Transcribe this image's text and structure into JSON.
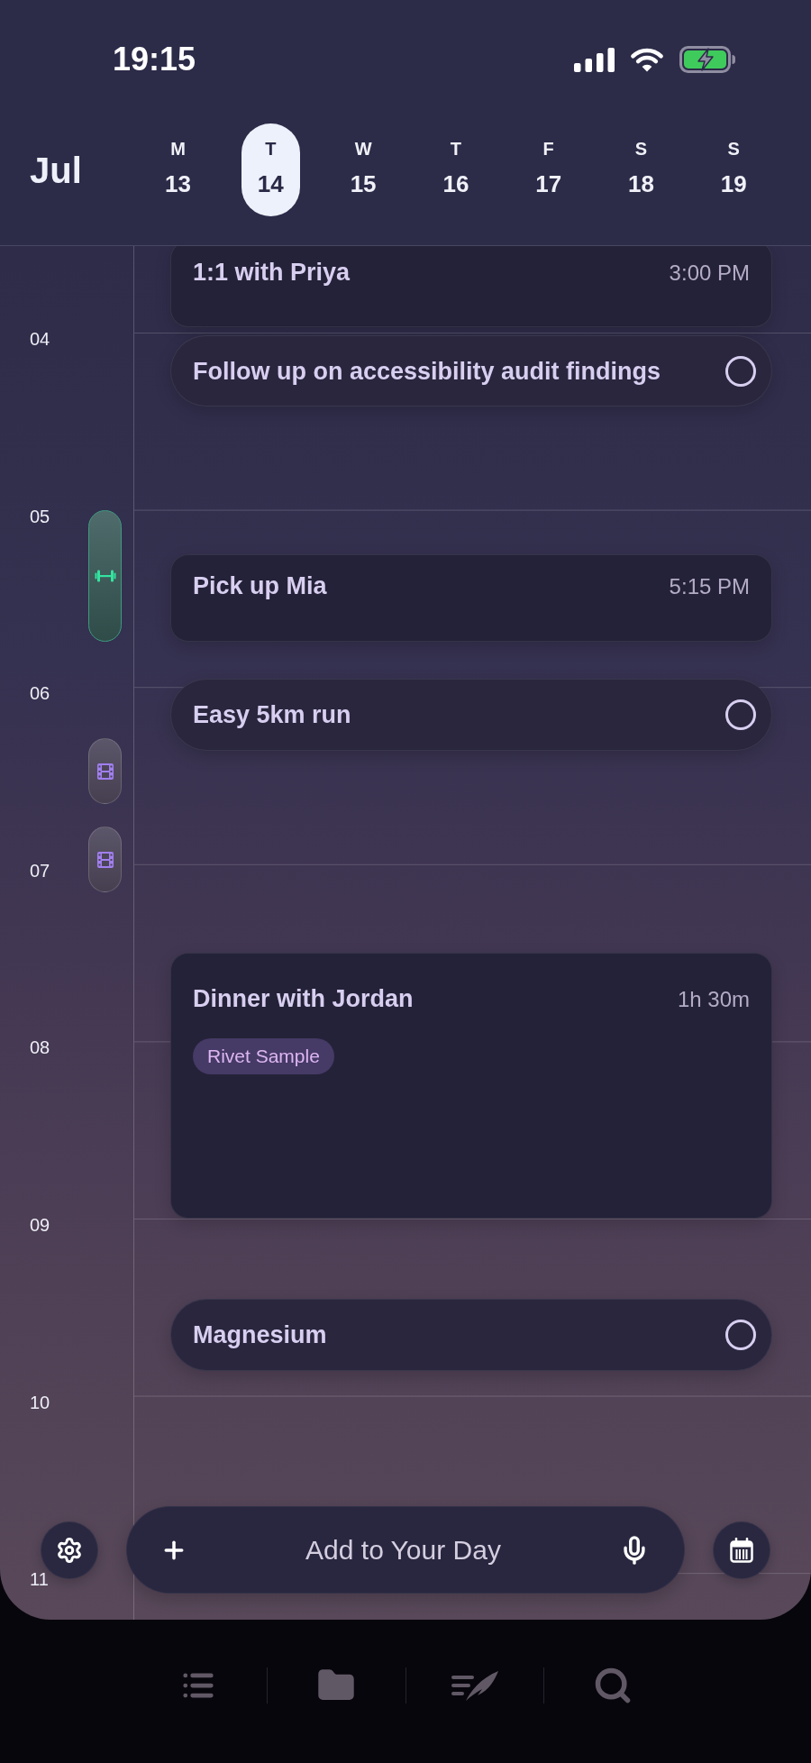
{
  "status_bar": {
    "time": "19:15"
  },
  "week": {
    "month": "Jul",
    "days": [
      {
        "weekday": "M",
        "date": "13",
        "selected": false
      },
      {
        "weekday": "T",
        "date": "14",
        "selected": true
      },
      {
        "weekday": "W",
        "date": "15",
        "selected": false
      },
      {
        "weekday": "T",
        "date": "16",
        "selected": false
      },
      {
        "weekday": "F",
        "date": "17",
        "selected": false
      },
      {
        "weekday": "S",
        "date": "18",
        "selected": false
      },
      {
        "weekday": "S",
        "date": "19",
        "selected": false
      }
    ]
  },
  "hours": [
    "04",
    "05",
    "06",
    "07",
    "08",
    "09",
    "10",
    "11"
  ],
  "rail_markers": [
    {
      "kind": "workout"
    },
    {
      "kind": "film"
    },
    {
      "kind": "film"
    }
  ],
  "events": [
    {
      "kind": "event",
      "title": "1:1 with Priya",
      "time": "3:00 PM"
    },
    {
      "kind": "task",
      "title": "Follow up on accessibility audit findings",
      "checked": false
    },
    {
      "kind": "event",
      "title": "Pick up Mia",
      "time": "5:15 PM"
    },
    {
      "kind": "task",
      "title": "Easy 5km run",
      "checked": false
    },
    {
      "kind": "event",
      "title": "Dinner with Jordan",
      "time": "1h 30m",
      "tag": "Rivet Sample"
    },
    {
      "kind": "task",
      "title": "Magnesium",
      "checked": false
    }
  ],
  "composer": {
    "placeholder": "Add to Your Day"
  }
}
